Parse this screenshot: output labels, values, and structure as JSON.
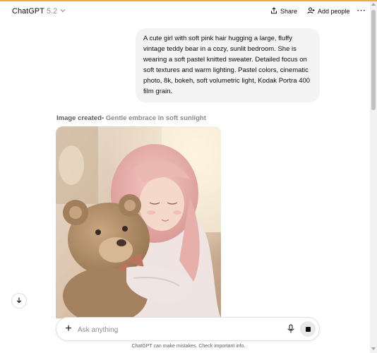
{
  "header": {
    "model_name": "ChatGPT",
    "model_version": "5.2",
    "share_label": "Share",
    "add_people_label": "Add people",
    "more_icon": "ellipsis-icon"
  },
  "conversation": {
    "user_message": "A cute girl with soft pink hair hugging a large, fluffy vintage teddy bear in a cozy, sunlit bedroom. She is wearing a soft pastel knitted sweater. Detailed focus on soft textures and warm lighting. Pastel colors, cinematic photo, 8k, bokeh, soft volumetric light, Kodak Portra 400 film grain.",
    "image_status": "Image created",
    "image_title": "• Gentle embrace in soft sunlight"
  },
  "composer": {
    "placeholder": "Ask anything",
    "plus_icon": "plus-icon",
    "mic_icon": "microphone-icon",
    "stop_icon": "stop-icon"
  },
  "footer": {
    "disclaimer": "ChatGPT can make mistakes. Check important info."
  },
  "colors": {
    "top_accent": "#f2a93b",
    "bubble_bg": "#f4f4f4",
    "text": "#0d0d0d",
    "muted": "#8f8f8f"
  }
}
